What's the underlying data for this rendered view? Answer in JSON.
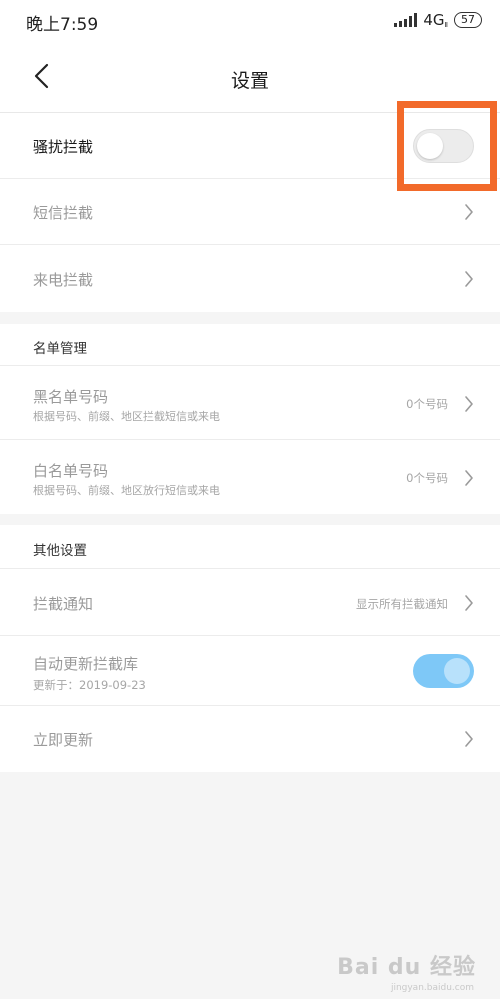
{
  "status_bar": {
    "time": "晚上7:59",
    "network": "4G",
    "network_sub": "Ⅱ",
    "battery": "57"
  },
  "nav": {
    "title": "设置"
  },
  "section_intercept": {
    "harassment_label": "骚扰拦截",
    "harassment_enabled": false,
    "sms_label": "短信拦截",
    "call_label": "来电拦截"
  },
  "section_list": {
    "header": "名单管理",
    "blacklist_label": "黑名单号码",
    "blacklist_sub": "根据号码、前缀、地区拦截短信或来电",
    "blacklist_value": "0个号码",
    "whitelist_label": "白名单号码",
    "whitelist_sub": "根据号码、前缀、地区放行短信或来电",
    "whitelist_value": "0个号码"
  },
  "section_other": {
    "header": "其他设置",
    "notify_label": "拦截通知",
    "notify_value": "显示所有拦截通知",
    "auto_update_label": "自动更新拦截库",
    "auto_update_sub": "更新于：2019-09-23",
    "auto_update_enabled": true,
    "update_now_label": "立即更新"
  },
  "colors": {
    "highlight": "#f26a2a",
    "toggle_on": "#7ec8f7"
  },
  "watermark": {
    "brand": "Bai du 经验",
    "url": "jingyan.baidu.com"
  }
}
